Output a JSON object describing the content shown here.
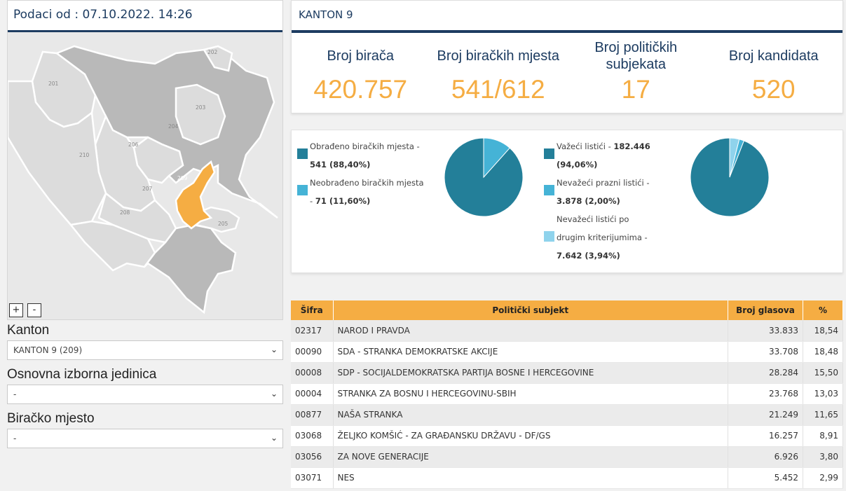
{
  "left": {
    "date_label": "Podaci od : 07.10.2022. 14:26",
    "map_labels": [
      "201",
      "202",
      "203",
      "204",
      "205",
      "206",
      "207",
      "208",
      "209",
      "210"
    ],
    "zoom_in": "+",
    "zoom_out": "-",
    "colors": {
      "selected": "#f5ad43",
      "dark": "#b9b9b9",
      "light": "#dcdcdc"
    }
  },
  "filters": {
    "kanton_label": "Kanton",
    "kanton_value": "KANTON 9 (209)",
    "oij_label": "Osnovna izborna jedinica",
    "oij_value": "-",
    "bm_label": "Biračko mjesto",
    "bm_value": "-"
  },
  "kanton": {
    "title": "KANTON 9",
    "stats": [
      {
        "label": "Broj birača",
        "value": "420.757"
      },
      {
        "label": "Broj biračkih mjesta",
        "value": "541/612"
      },
      {
        "label": "Broj političkih subjekata",
        "value": "17"
      },
      {
        "label": "Broj kandidata",
        "value": "520"
      }
    ]
  },
  "pies": {
    "left_legend": [
      {
        "text": "Obrađeno biračkih mjesta - ",
        "bold": "541 (88,40%)",
        "color": "#237f99"
      },
      {
        "text": "Neobrađeno biračkih mjesta - ",
        "bold": "71 (11,60%)",
        "color": "#45b3d6"
      }
    ],
    "right_legend": [
      {
        "text": "Važeći listići - ",
        "bold": "182.446 (94,06%)",
        "color": "#237f99"
      },
      {
        "text": "Nevažeći prazni listići - ",
        "bold": "3.878 (2,00%)",
        "color": "#45b3d6"
      },
      {
        "text": "Nevažeći listići po drugim kriterijumima - ",
        "bold": "7.642 (3,94%)",
        "color": "#8fd3ec"
      }
    ]
  },
  "chart_data": [
    {
      "type": "pie",
      "categories": [
        "Obrađeno biračkih mjesta",
        "Neobrađeno biračkih mjesta"
      ],
      "values": [
        88.4,
        11.6
      ],
      "colors": [
        "#237f99",
        "#45b3d6"
      ]
    },
    {
      "type": "pie",
      "categories": [
        "Važeći listići",
        "Nevažeći prazni listići",
        "Nevažeći listići po drugim kriterijumima"
      ],
      "values": [
        94.06,
        2.0,
        3.94
      ],
      "colors": [
        "#237f99",
        "#45b3d6",
        "#8fd3ec"
      ]
    }
  ],
  "table": {
    "headers": [
      "Šifra",
      "Politički subjekt",
      "Broj glasova",
      "%"
    ],
    "rows": [
      [
        "02317",
        "NAROD I PRAVDA",
        "33.833",
        "18,54"
      ],
      [
        "00090",
        "SDA - STRANKA DEMOKRATSKE AKCIJE",
        "33.708",
        "18,48"
      ],
      [
        "00008",
        "SDP - SOCIJALDEMOKRATSKA PARTIJA BOSNE I HERCEGOVINE",
        "28.284",
        "15,50"
      ],
      [
        "00004",
        "STRANKA ZA BOSNU I HERCEGOVINU-SBIH",
        "23.768",
        "13,03"
      ],
      [
        "00877",
        "NAŠA STRANKA",
        "21.249",
        "11,65"
      ],
      [
        "03068",
        "ŽELJKO KOMŠIĆ - ZA GRAĐANSKU DRŽAVU - DF/GS",
        "16.257",
        "8,91"
      ],
      [
        "03056",
        "ZA NOVE GENERACIJE",
        "6.926",
        "3,80"
      ],
      [
        "03071",
        "NES",
        "5.452",
        "2,99"
      ]
    ]
  }
}
